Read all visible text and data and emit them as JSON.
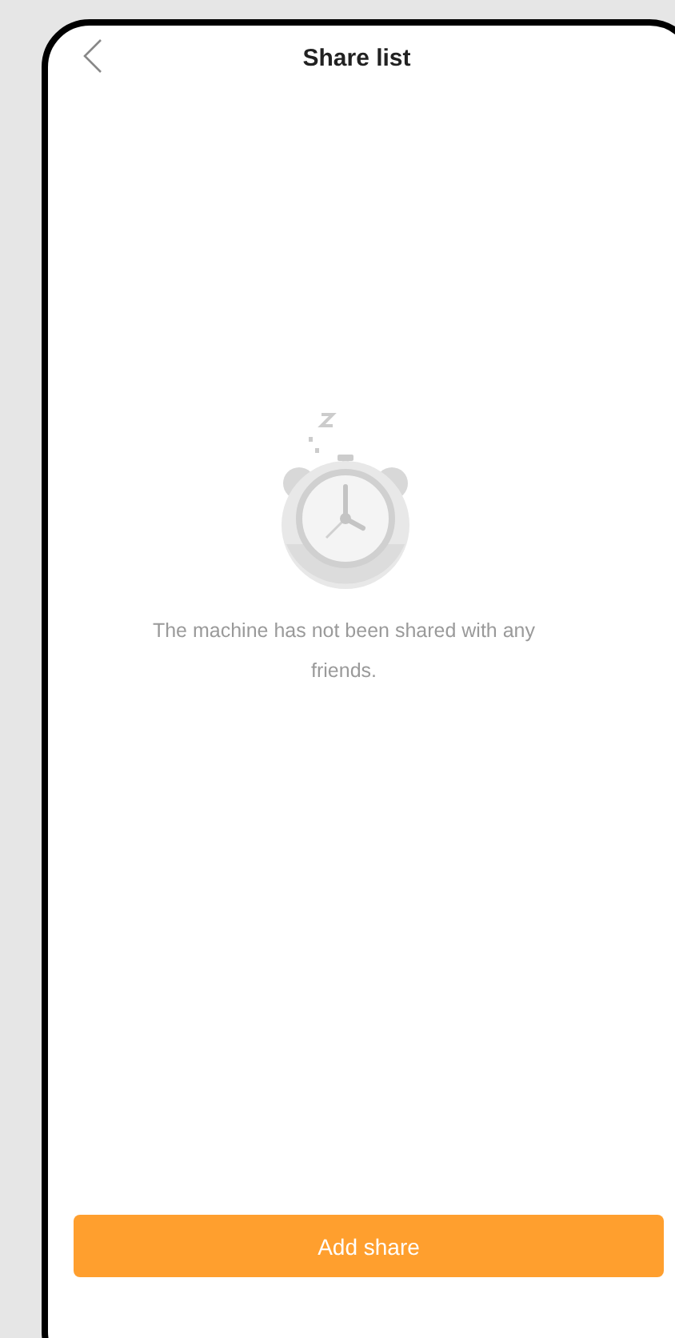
{
  "header": {
    "title": "Share list"
  },
  "empty_state": {
    "message": "The machine has not been shared with any friends."
  },
  "buttons": [
    {
      "label": "Add share"
    }
  ]
}
